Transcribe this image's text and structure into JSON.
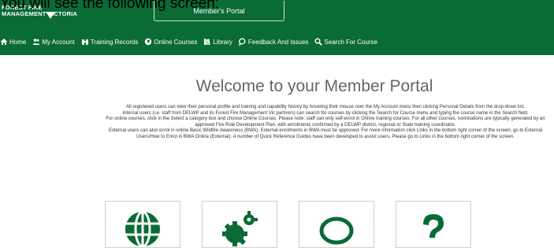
{
  "overlay_caption": "You will see the following screen:",
  "header": {
    "logo_line1": "FOREST FIRE",
    "logo_line2": "MANAGEMENT VICTORIA",
    "portal_label": "Member's Portal",
    "bg_color": "#0a6b35"
  },
  "nav": {
    "items": [
      {
        "label": "Home",
        "icon": "home-icon"
      },
      {
        "label": "My Account",
        "icon": "users-icon"
      },
      {
        "label": "Training Records",
        "icon": "binoculars-icon"
      },
      {
        "label": "Online Courses",
        "icon": "globe-icon"
      },
      {
        "label": "Library",
        "icon": "books-icon"
      },
      {
        "label": "Feedback And Issues",
        "icon": "comment-icon"
      },
      {
        "label": "Search For Course",
        "icon": "search-icon"
      }
    ]
  },
  "main": {
    "title": "Welcome to your Member Portal",
    "paragraphs": [
      "All registered users can view their personal profile and training and capability history by hovering their mouse over the My Account menu then clicking Personal Details from the drop-down list.",
      "Internal users (i.e. staff from DELWP and its Forest Fire Management Vic partners) can search for courses by clicking the Search for Course menu and typing the course name in the Search field.",
      "For online courses, click in the Select a category box and choose Online Courses.   Please note: staff can only self-enrol in Online training courses. For all other courses, nominations are typically generated by an approved Fire Role Development Plan, with enrolments confirmed by a DELWP district, regional or State training coordinator.",
      "External users can also enrol in online Basic Wildfire Awareness (BWA). External enrolments in BWA must be approved. For more information click Links in the bottom right corner of the screen, go to External Users/How to Enrol in BWA Online (External). A number of Quick Reference Guides have been developed to assist users.  Please go to Links in the bottom right corner of the screen."
    ],
    "tiles": [
      {
        "icon": "globe-icon"
      },
      {
        "icon": "gears-icon"
      },
      {
        "icon": "chat-bubble-icon"
      },
      {
        "icon": "question-icon"
      }
    ]
  }
}
